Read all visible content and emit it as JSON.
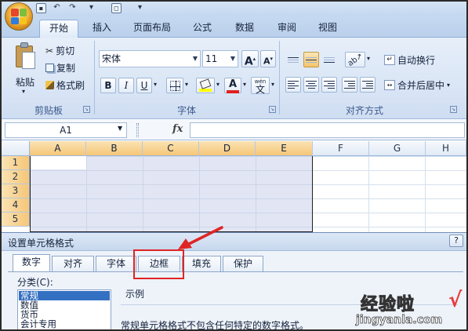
{
  "tabs": [
    "开始",
    "插入",
    "页面布局",
    "公式",
    "数据",
    "审阅",
    "视图"
  ],
  "active_tab_index": 0,
  "clipboard": {
    "paste": "粘贴",
    "cut": "剪切",
    "copy": "复制",
    "format_painter": "格式刷",
    "group": "剪贴板"
  },
  "font": {
    "name": "宋体",
    "size": "11",
    "grow": "A",
    "shrink": "A",
    "bold": "B",
    "italic": "I",
    "underline": "U",
    "font_color": "A",
    "wen": "wén",
    "wen_char": "文",
    "group": "字体",
    "fill_color": "#ffff00",
    "text_color": "#e02020"
  },
  "alignment": {
    "wrap": "自动换行",
    "merge": "合并后居中",
    "merge_arrow": "▾",
    "group": "对齐方式"
  },
  "formula_bar": {
    "name_box": "A1",
    "fx": "fx",
    "value": ""
  },
  "columns": [
    "A",
    "B",
    "C",
    "D",
    "E",
    "F",
    "G",
    "H"
  ],
  "rows": [
    "1",
    "2",
    "3",
    "4",
    "5"
  ],
  "dialog": {
    "title": "设置单元格格式",
    "help": "?",
    "tabs": [
      "数字",
      "对齐",
      "字体",
      "边框",
      "填充",
      "保护"
    ],
    "active_tab": "数字",
    "highlighted_tab": "边框",
    "category_label": "分类(C):",
    "categories": [
      "常规",
      "数值",
      "货币",
      "会计专用"
    ],
    "selected_category": "常规",
    "sample_label": "示例",
    "description": "常规单元格格式不包含任何特定的数字格式。"
  },
  "watermark": {
    "title": "经验啦",
    "check": "√",
    "url": "jingyanla.com"
  },
  "colors": {
    "selected_header": "#f5c677",
    "annotation_red": "#e02424",
    "ribbon": "#dae6f6"
  }
}
